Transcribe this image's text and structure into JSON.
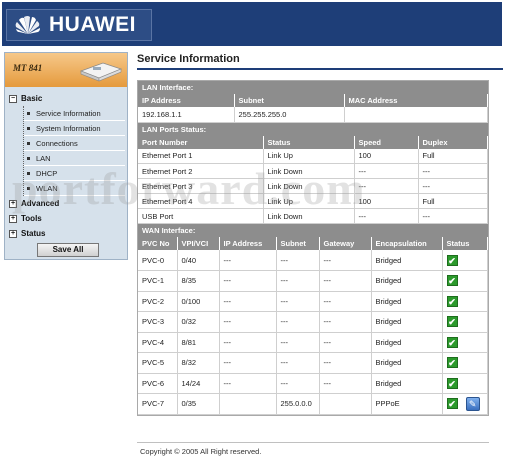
{
  "header": {
    "brand": "HUAWEI"
  },
  "device": {
    "model": "MT 841"
  },
  "menu": {
    "basic": "Basic",
    "basic_items": [
      "Service Information",
      "System Information",
      "Connections",
      "LAN",
      "DHCP",
      "WLAN"
    ],
    "advanced": "Advanced",
    "tools": "Tools",
    "status": "Status",
    "expand_symbol": "+",
    "collapse_symbol": "−",
    "save": "Save All"
  },
  "page": {
    "title": "Service Information"
  },
  "lan": {
    "section": "LAN Interface:",
    "headers": [
      "IP Address",
      "Subnet",
      "MAC Address"
    ],
    "row": [
      "192.168.1.1",
      "255.255.255.0",
      ""
    ]
  },
  "ports": {
    "section": "LAN Ports Status:",
    "headers": [
      "Port Number",
      "Status",
      "Speed",
      "Duplex"
    ],
    "rows": [
      [
        "Ethernet Port 1",
        "Link Up",
        "100",
        "Full"
      ],
      [
        "Ethernet Port 2",
        "Link Down",
        "---",
        "---"
      ],
      [
        "Ethernet Port 3",
        "Link Down",
        "---",
        "---"
      ],
      [
        "Ethernet Port 4",
        "Link Up",
        "100",
        "Full"
      ],
      [
        "USB Port",
        "Link Down",
        "---",
        "---"
      ]
    ]
  },
  "wan": {
    "section": "WAN Interface:",
    "headers": [
      "PVC No",
      "VPI/VCI",
      "IP Address",
      "Subnet",
      "Gateway",
      "Encapsulation",
      "Status"
    ],
    "rows": [
      [
        "PVC-0",
        "0/40",
        "---",
        "---",
        "---",
        "Bridged"
      ],
      [
        "PVC-1",
        "8/35",
        "---",
        "---",
        "---",
        "Bridged"
      ],
      [
        "PVC-2",
        "0/100",
        "---",
        "---",
        "---",
        "Bridged"
      ],
      [
        "PVC-3",
        "0/32",
        "---",
        "---",
        "---",
        "Bridged"
      ],
      [
        "PVC-4",
        "8/81",
        "---",
        "---",
        "---",
        "Bridged"
      ],
      [
        "PVC-5",
        "8/32",
        "---",
        "---",
        "---",
        "Bridged"
      ],
      [
        "PVC-6",
        "14/24",
        "---",
        "---",
        "---",
        "Bridged"
      ],
      [
        "PVC-7",
        "0/35",
        "",
        "255.0.0.0",
        "",
        "PPPoE"
      ]
    ],
    "status_icon": "check-icon",
    "status_symbol": "✔",
    "edit_symbol": "✎"
  },
  "footer": {
    "copyright": "Copyright © 2005 All Right reserved."
  },
  "watermark": {
    "text": "portforward.com"
  },
  "colors": {
    "header": "#1e3e78",
    "table_head": "#8d8d8d",
    "sidebar": "#d6e1eb",
    "status_ok": "#2c9a2c"
  }
}
